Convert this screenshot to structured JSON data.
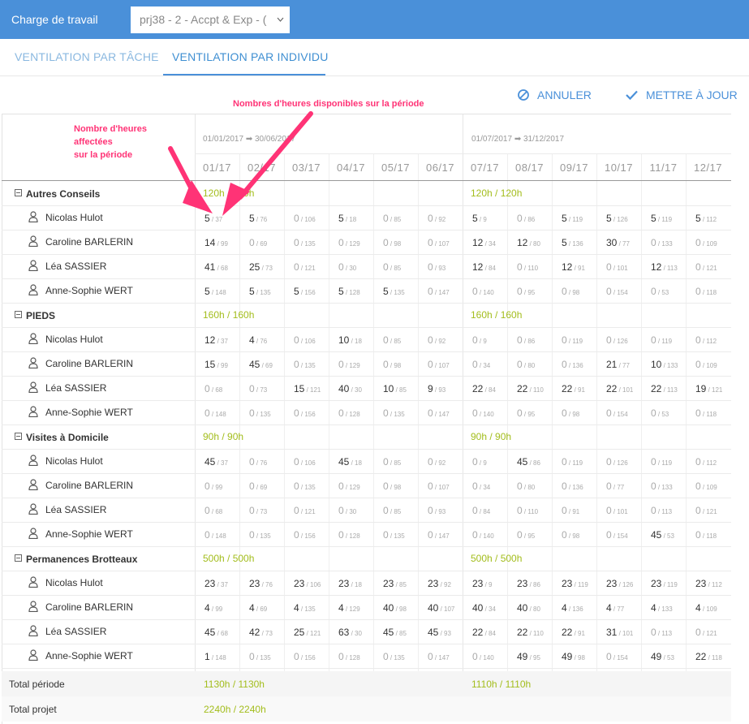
{
  "header": {
    "title": "Charge de travail",
    "project_value": "prj38 - 2 - Accpt & Exp - (",
    "project_chevron": "chevron-down-icon"
  },
  "tabs": [
    {
      "label": "VENTILATION PAR TÂCHE",
      "active": false
    },
    {
      "label": "VENTILATION PAR INDIVIDU",
      "active": true
    }
  ],
  "actions": {
    "cancel_label": "ANNULER",
    "update_label": "METTRE À JOUR"
  },
  "annotations": {
    "assigned_hours": "Nombre d'heures\naffectées\nsur la période",
    "available_hours": "Nombres d'heures disponibles sur la période",
    "color": "#ff3376"
  },
  "periods": [
    {
      "label": "01/01/2017 ➡ 30/06/2017",
      "months": [
        "01/17",
        "02/17",
        "03/17",
        "04/17",
        "05/17",
        "06/17"
      ]
    },
    {
      "label": "01/07/2017 ➡ 31/12/2017",
      "months": [
        "07/17",
        "08/17",
        "09/17",
        "10/17",
        "11/17",
        "12/17"
      ]
    }
  ],
  "groups": [
    {
      "name": "Autres Conseils",
      "totals": [
        "120h / 120h",
        "120h / 120h"
      ],
      "people": [
        {
          "name": "Nicolas Hulot",
          "cells": [
            [
              "5",
              "37"
            ],
            [
              "5",
              "76"
            ],
            [
              "0",
              "106"
            ],
            [
              "5",
              "18"
            ],
            [
              "0",
              "85"
            ],
            [
              "0",
              "92"
            ],
            [
              "5",
              "9"
            ],
            [
              "0",
              "86"
            ],
            [
              "5",
              "119"
            ],
            [
              "5",
              "126"
            ],
            [
              "5",
              "119"
            ],
            [
              "5",
              "112"
            ]
          ]
        },
        {
          "name": "Caroline BARLERIN",
          "cells": [
            [
              "14",
              "99"
            ],
            [
              "0",
              "69"
            ],
            [
              "0",
              "135"
            ],
            [
              "0",
              "129"
            ],
            [
              "0",
              "98"
            ],
            [
              "0",
              "107"
            ],
            [
              "12",
              "34"
            ],
            [
              "12",
              "80"
            ],
            [
              "5",
              "136"
            ],
            [
              "30",
              "77"
            ],
            [
              "0",
              "133"
            ],
            [
              "0",
              "109"
            ]
          ]
        },
        {
          "name": "Léa SASSIER",
          "cells": [
            [
              "41",
              "68"
            ],
            [
              "25",
              "73"
            ],
            [
              "0",
              "121"
            ],
            [
              "0",
              "30"
            ],
            [
              "0",
              "85"
            ],
            [
              "0",
              "93"
            ],
            [
              "12",
              "84"
            ],
            [
              "0",
              "110"
            ],
            [
              "12",
              "91"
            ],
            [
              "0",
              "101"
            ],
            [
              "12",
              "113"
            ],
            [
              "0",
              "121"
            ]
          ]
        },
        {
          "name": "Anne-Sophie WERT",
          "cells": [
            [
              "5",
              "148"
            ],
            [
              "5",
              "135"
            ],
            [
              "5",
              "156"
            ],
            [
              "5",
              "128"
            ],
            [
              "5",
              "135"
            ],
            [
              "0",
              "147"
            ],
            [
              "0",
              "140"
            ],
            [
              "0",
              "95"
            ],
            [
              "0",
              "98"
            ],
            [
              "0",
              "154"
            ],
            [
              "0",
              "53"
            ],
            [
              "0",
              "118"
            ]
          ]
        }
      ]
    },
    {
      "name": "PIEDS",
      "totals": [
        "160h / 160h",
        "160h / 160h"
      ],
      "people": [
        {
          "name": "Nicolas Hulot",
          "cells": [
            [
              "12",
              "37"
            ],
            [
              "4",
              "76"
            ],
            [
              "0",
              "106"
            ],
            [
              "10",
              "18"
            ],
            [
              "0",
              "85"
            ],
            [
              "0",
              "92"
            ],
            [
              "0",
              "9"
            ],
            [
              "0",
              "86"
            ],
            [
              "0",
              "119"
            ],
            [
              "0",
              "126"
            ],
            [
              "0",
              "119"
            ],
            [
              "0",
              "112"
            ]
          ]
        },
        {
          "name": "Caroline BARLERIN",
          "cells": [
            [
              "15",
              "99"
            ],
            [
              "45",
              "69"
            ],
            [
              "0",
              "135"
            ],
            [
              "0",
              "129"
            ],
            [
              "0",
              "98"
            ],
            [
              "0",
              "107"
            ],
            [
              "0",
              "34"
            ],
            [
              "0",
              "80"
            ],
            [
              "0",
              "136"
            ],
            [
              "21",
              "77"
            ],
            [
              "10",
              "133"
            ],
            [
              "0",
              "109"
            ]
          ]
        },
        {
          "name": "Léa SASSIER",
          "cells": [
            [
              "0",
              "68"
            ],
            [
              "0",
              "73"
            ],
            [
              "15",
              "121"
            ],
            [
              "40",
              "30"
            ],
            [
              "10",
              "85"
            ],
            [
              "9",
              "93"
            ],
            [
              "22",
              "84"
            ],
            [
              "22",
              "110"
            ],
            [
              "22",
              "91"
            ],
            [
              "22",
              "101"
            ],
            [
              "22",
              "113"
            ],
            [
              "19",
              "121"
            ]
          ]
        },
        {
          "name": "Anne-Sophie WERT",
          "cells": [
            [
              "0",
              "148"
            ],
            [
              "0",
              "135"
            ],
            [
              "0",
              "156"
            ],
            [
              "0",
              "128"
            ],
            [
              "0",
              "135"
            ],
            [
              "0",
              "147"
            ],
            [
              "0",
              "140"
            ],
            [
              "0",
              "95"
            ],
            [
              "0",
              "98"
            ],
            [
              "0",
              "154"
            ],
            [
              "0",
              "53"
            ],
            [
              "0",
              "118"
            ]
          ]
        }
      ]
    },
    {
      "name": "Visites à Domicile",
      "totals": [
        "90h / 90h",
        "90h / 90h"
      ],
      "people": [
        {
          "name": "Nicolas Hulot",
          "cells": [
            [
              "45",
              "37"
            ],
            [
              "0",
              "76"
            ],
            [
              "0",
              "106"
            ],
            [
              "45",
              "18"
            ],
            [
              "0",
              "85"
            ],
            [
              "0",
              "92"
            ],
            [
              "0",
              "9"
            ],
            [
              "45",
              "86"
            ],
            [
              "0",
              "119"
            ],
            [
              "0",
              "126"
            ],
            [
              "0",
              "119"
            ],
            [
              "0",
              "112"
            ]
          ]
        },
        {
          "name": "Caroline BARLERIN",
          "cells": [
            [
              "0",
              "99"
            ],
            [
              "0",
              "69"
            ],
            [
              "0",
              "135"
            ],
            [
              "0",
              "129"
            ],
            [
              "0",
              "98"
            ],
            [
              "0",
              "107"
            ],
            [
              "0",
              "34"
            ],
            [
              "0",
              "80"
            ],
            [
              "0",
              "136"
            ],
            [
              "0",
              "77"
            ],
            [
              "0",
              "133"
            ],
            [
              "0",
              "109"
            ]
          ]
        },
        {
          "name": "Léa SASSIER",
          "cells": [
            [
              "0",
              "68"
            ],
            [
              "0",
              "73"
            ],
            [
              "0",
              "121"
            ],
            [
              "0",
              "30"
            ],
            [
              "0",
              "85"
            ],
            [
              "0",
              "93"
            ],
            [
              "0",
              "84"
            ],
            [
              "0",
              "110"
            ],
            [
              "0",
              "91"
            ],
            [
              "0",
              "101"
            ],
            [
              "0",
              "113"
            ],
            [
              "0",
              "121"
            ]
          ]
        },
        {
          "name": "Anne-Sophie WERT",
          "cells": [
            [
              "0",
              "148"
            ],
            [
              "0",
              "135"
            ],
            [
              "0",
              "156"
            ],
            [
              "0",
              "128"
            ],
            [
              "0",
              "135"
            ],
            [
              "0",
              "147"
            ],
            [
              "0",
              "140"
            ],
            [
              "0",
              "95"
            ],
            [
              "0",
              "98"
            ],
            [
              "0",
              "154"
            ],
            [
              "45",
              "53"
            ],
            [
              "0",
              "118"
            ]
          ]
        }
      ]
    },
    {
      "name": "Permanences Brotteaux",
      "totals": [
        "500h / 500h",
        "500h / 500h"
      ],
      "people": [
        {
          "name": "Nicolas Hulot",
          "cells": [
            [
              "23",
              "37"
            ],
            [
              "23",
              "76"
            ],
            [
              "23",
              "106"
            ],
            [
              "23",
              "18"
            ],
            [
              "23",
              "85"
            ],
            [
              "23",
              "92"
            ],
            [
              "23",
              "9"
            ],
            [
              "23",
              "86"
            ],
            [
              "23",
              "119"
            ],
            [
              "23",
              "126"
            ],
            [
              "23",
              "119"
            ],
            [
              "23",
              "112"
            ]
          ]
        },
        {
          "name": "Caroline BARLERIN",
          "cells": [
            [
              "4",
              "99"
            ],
            [
              "4",
              "69"
            ],
            [
              "4",
              "135"
            ],
            [
              "4",
              "129"
            ],
            [
              "40",
              "98"
            ],
            [
              "40",
              "107"
            ],
            [
              "40",
              "34"
            ],
            [
              "40",
              "80"
            ],
            [
              "4",
              "136"
            ],
            [
              "4",
              "77"
            ],
            [
              "4",
              "133"
            ],
            [
              "4",
              "109"
            ]
          ]
        },
        {
          "name": "Léa SASSIER",
          "cells": [
            [
              "45",
              "68"
            ],
            [
              "42",
              "73"
            ],
            [
              "25",
              "121"
            ],
            [
              "63",
              "30"
            ],
            [
              "45",
              "85"
            ],
            [
              "45",
              "93"
            ],
            [
              "22",
              "84"
            ],
            [
              "22",
              "110"
            ],
            [
              "22",
              "91"
            ],
            [
              "31",
              "101"
            ],
            [
              "0",
              "113"
            ],
            [
              "0",
              "121"
            ]
          ]
        },
        {
          "name": "Anne-Sophie WERT",
          "cells": [
            [
              "1",
              "148"
            ],
            [
              "0",
              "135"
            ],
            [
              "0",
              "156"
            ],
            [
              "0",
              "128"
            ],
            [
              "0",
              "135"
            ],
            [
              "0",
              "147"
            ],
            [
              "0",
              "140"
            ],
            [
              "49",
              "95"
            ],
            [
              "49",
              "98"
            ],
            [
              "0",
              "154"
            ],
            [
              "49",
              "53"
            ],
            [
              "22",
              "118"
            ]
          ]
        }
      ]
    }
  ],
  "footer": {
    "total_period_label": "Total période",
    "total_period": [
      "1130h / 1130h",
      "1110h / 1110h"
    ],
    "total_project_label": "Total projet",
    "total_project": "2240h / 2240h"
  },
  "colors": {
    "brand": "#4a90d9",
    "total_green": "#a3bd1c",
    "annotation": "#ff3376"
  }
}
